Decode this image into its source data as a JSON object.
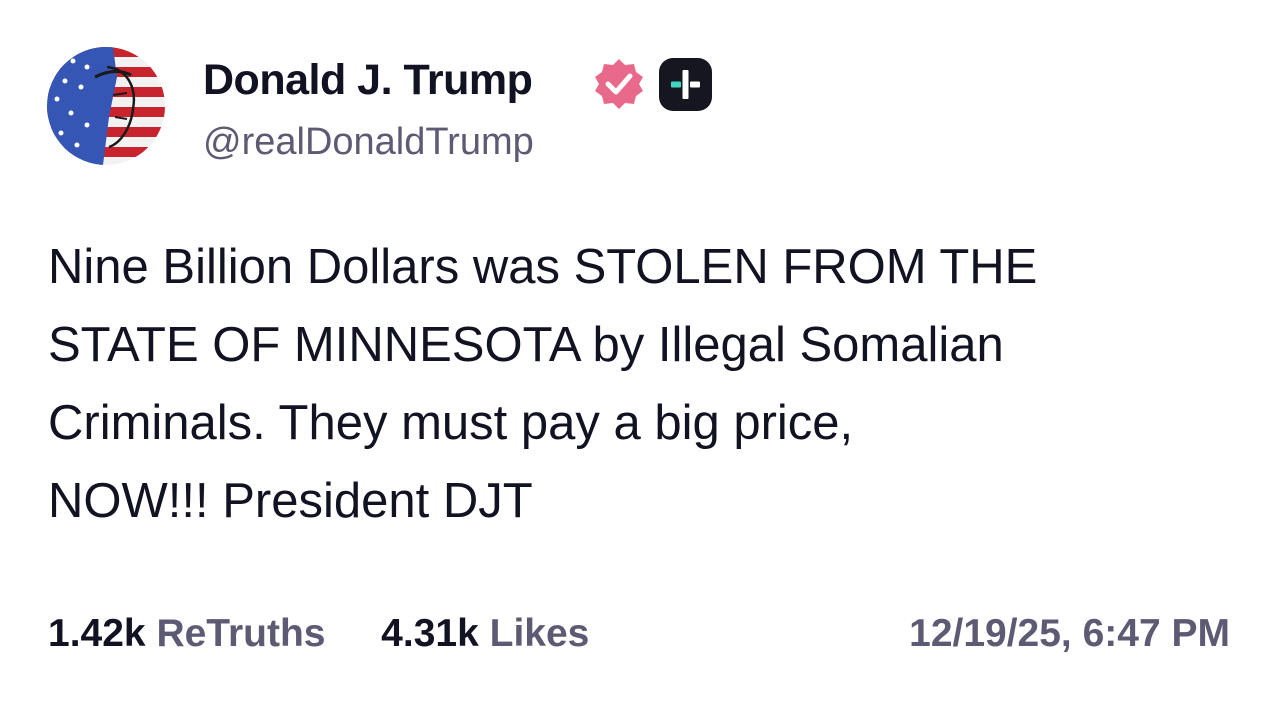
{
  "author": {
    "display_name": "Donald J. Trump",
    "handle": "@realDonaldTrump",
    "avatar_icon": "flag-face-avatar",
    "verified_icon": "verified-badge-icon",
    "subscription_icon": "plus-badge-icon"
  },
  "post": {
    "text": "Nine Billion Dollars was STOLEN FROM THE\nSTATE OF MINNESOTA by Illegal Somalian\nCriminals. They must pay a big price,\nNOW!!! President DJT"
  },
  "stats": {
    "retruths_count": "1.42k",
    "retruths_label": "ReTruths",
    "likes_count": "4.31k",
    "likes_label": "Likes"
  },
  "timestamp": "12/19/25, 6:47 PM",
  "colors": {
    "text_primary": "#111322",
    "text_secondary": "#5d5b73",
    "verified_pink": "#e9698a",
    "plus_badge_bg": "#15161f",
    "plus_badge_accent": "#3fd6c0"
  }
}
